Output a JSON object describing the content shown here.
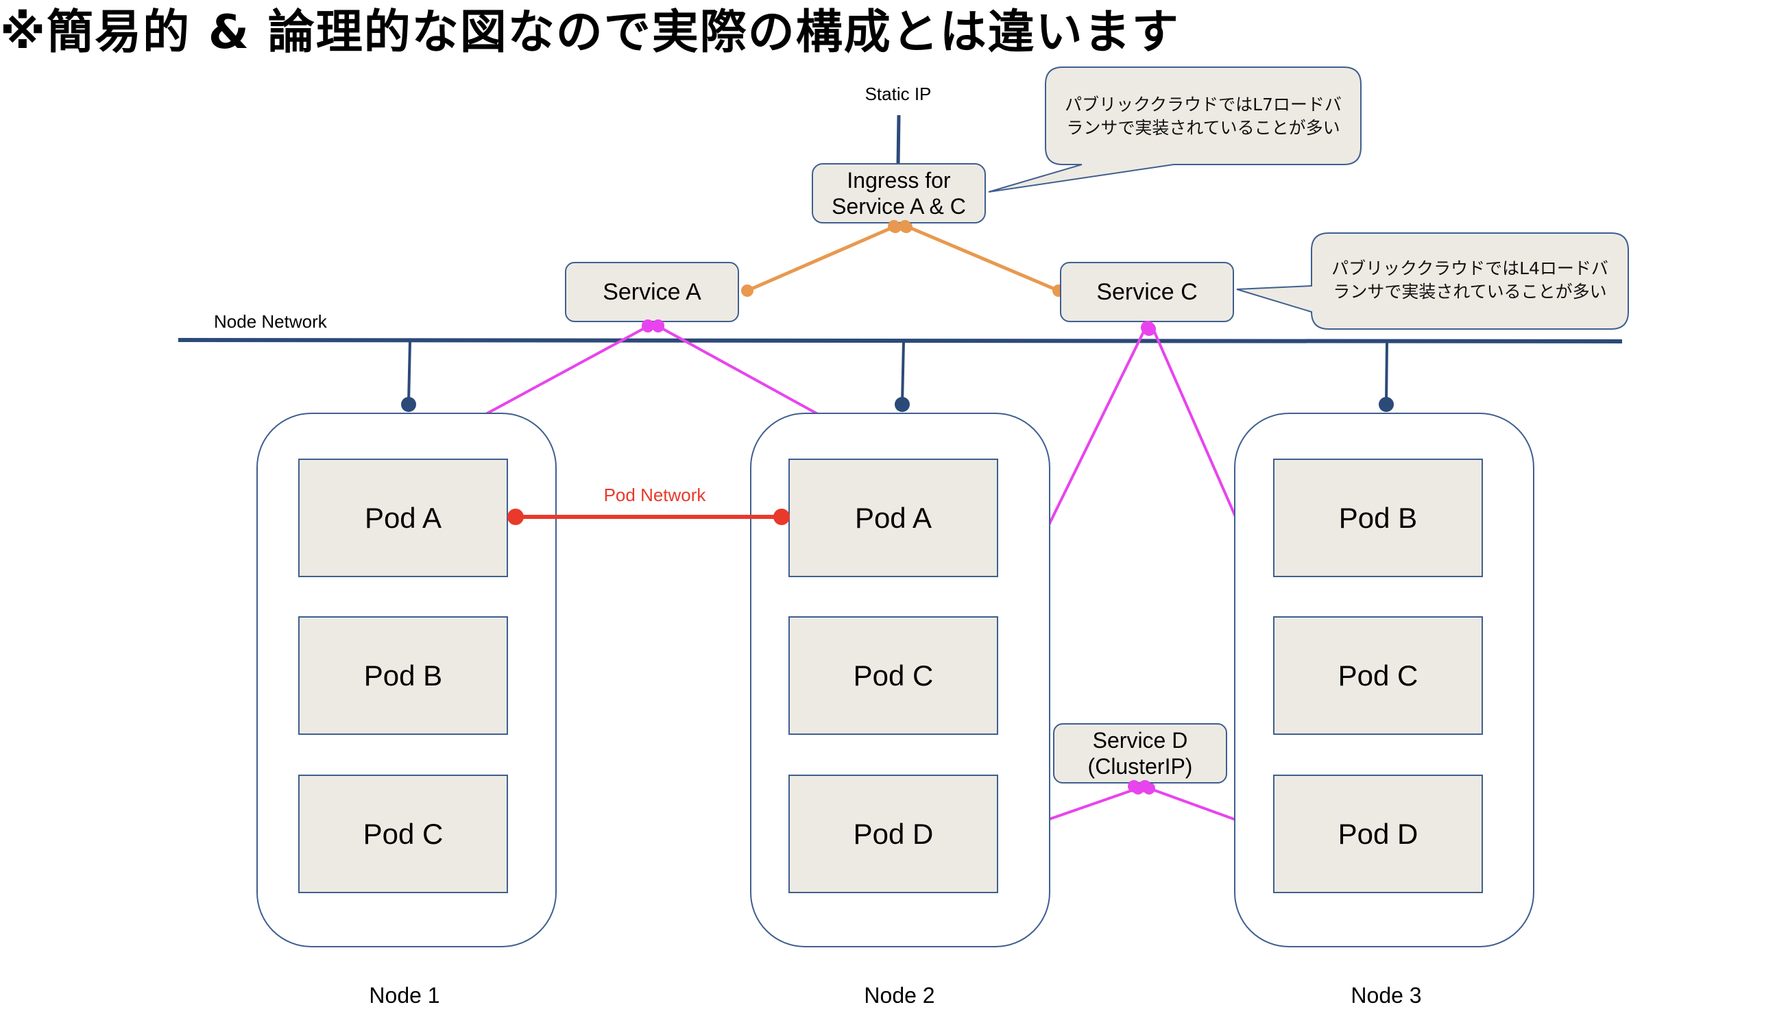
{
  "title": "※簡易的 & 論理的な図なので実際の構成とは違います",
  "labels": {
    "static_ip": "Static IP",
    "node_network": "Node Network",
    "pod_network": "Pod Network"
  },
  "ingress": {
    "line1": "Ingress for",
    "line2": "Service A & C"
  },
  "services": {
    "a": "Service A",
    "c": "Service C",
    "d_line1": "Service D",
    "d_line2": "(ClusterIP)"
  },
  "callouts": {
    "l7": {
      "line1": "パブリッククラウドではL7ロードバ",
      "line2": "ランサで実装されていることが多い"
    },
    "l4": {
      "line1": "パブリッククラウドではL4ロードバ",
      "line2": "ランサで実装されていることが多い"
    }
  },
  "nodes": [
    {
      "label": "Node 1",
      "pods": [
        "Pod A",
        "Pod B",
        "Pod C"
      ]
    },
    {
      "label": "Node 2",
      "pods": [
        "Pod A",
        "Pod C",
        "Pod D"
      ]
    },
    {
      "label": "Node 3",
      "pods": [
        "Pod B",
        "Pod C",
        "Pod D"
      ]
    }
  ],
  "colors": {
    "node_network": "#2c4a78",
    "ingress_link": "#e8994f",
    "service_link": "#e844ee",
    "pod_network": "#e8392b",
    "box_fill": "#edeae3",
    "box_border": "#3f5f8f"
  }
}
